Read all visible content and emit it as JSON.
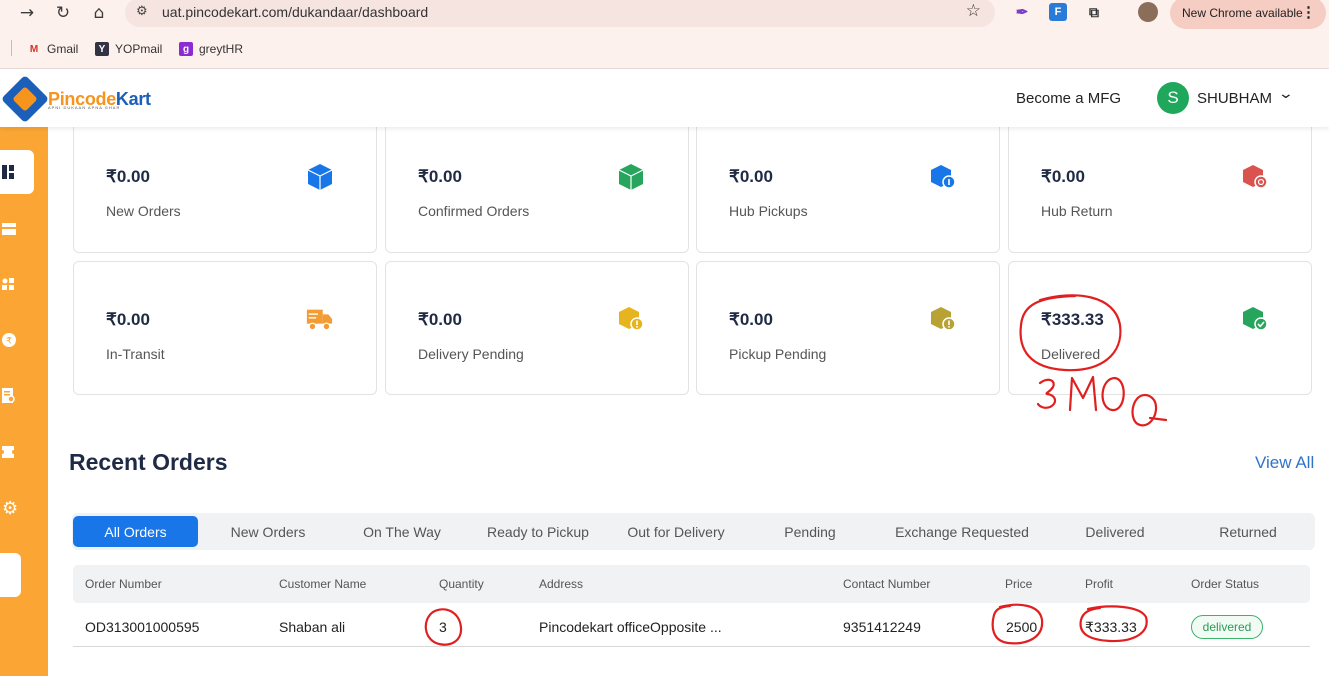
{
  "browser": {
    "url": "uat.pincodekart.com/dukandaar/dashboard",
    "update_label": "New Chrome available",
    "bookmarks": [
      {
        "label": "Gmail"
      },
      {
        "label": "YOPmail"
      },
      {
        "label": "greytHR"
      }
    ]
  },
  "header": {
    "logo_text_a": "Pincode",
    "logo_text_b": "Kart",
    "logo_tagline": "APNI DUKAAN APNA GHAR",
    "become_mfg": "Become a MFG",
    "user_initial": "S",
    "user_name": "SHUBHAM"
  },
  "stats": [
    {
      "amount": "₹0.00",
      "label": "New Orders",
      "icon": "box-icon",
      "color": "#1976e8"
    },
    {
      "amount": "₹0.00",
      "label": "Confirmed Orders",
      "icon": "box-icon",
      "color": "#27a55d"
    },
    {
      "amount": "₹0.00",
      "label": "Hub Pickups",
      "icon": "box-info-icon",
      "color": "#1976e8"
    },
    {
      "amount": "₹0.00",
      "label": "Hub Return",
      "icon": "box-return-icon",
      "color": "#d9534f"
    },
    {
      "amount": "₹0.00",
      "label": "In-Transit",
      "icon": "truck-icon",
      "color": "#f39c34"
    },
    {
      "amount": "₹0.00",
      "label": "Delivery Pending",
      "icon": "box-pending-icon",
      "color": "#e6b41e"
    },
    {
      "amount": "₹0.00",
      "label": "Pickup Pending",
      "icon": "box-pending-icon",
      "color": "#b8a234"
    },
    {
      "amount": "₹333.33",
      "label": "Delivered",
      "icon": "box-check-icon",
      "color": "#27a55d"
    }
  ],
  "recent_orders": {
    "title": "Recent Orders",
    "view_all": "View All",
    "tabs": [
      "All Orders",
      "New Orders",
      "On The Way",
      "Ready to Pickup",
      "Out for Delivery",
      "Pending",
      "Exchange Requested",
      "Delivered",
      "Returned"
    ],
    "columns": [
      "Order Number",
      "Customer Name",
      "Quantity",
      "Address",
      "Contact Number",
      "Price",
      "Profit",
      "Order Status"
    ],
    "rows": [
      {
        "order_number": "OD313001000595",
        "customer_name": "Shaban ali",
        "quantity": "3",
        "address": "Pincodekart officeOpposite ...",
        "contact": "9351412249",
        "price": "2500",
        "profit": "₹333.33",
        "status": "delivered"
      }
    ]
  },
  "annotation": {
    "handwritten_note": "3 MOQ",
    "color": "#e02020"
  }
}
